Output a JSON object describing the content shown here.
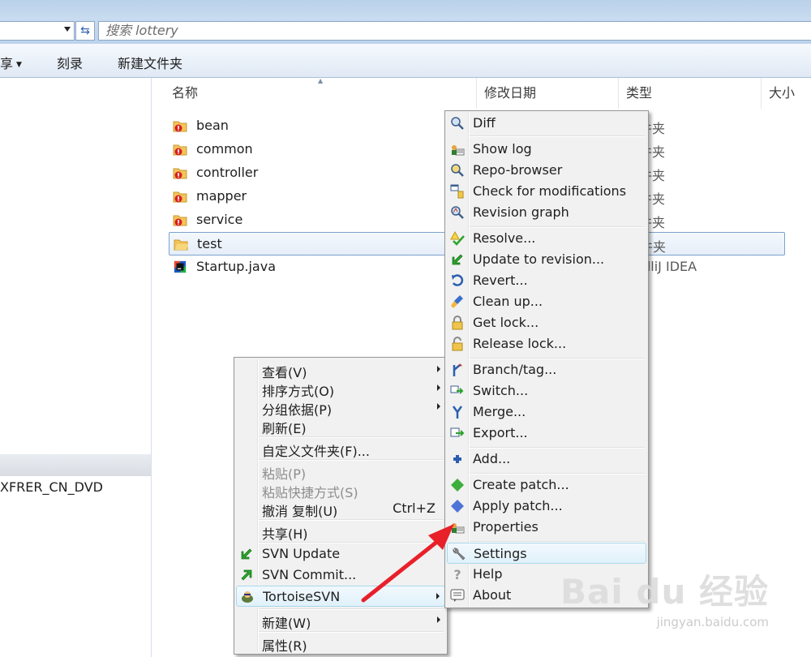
{
  "address_bar": {
    "search_placeholder": "搜索 lottery"
  },
  "toolbar": {
    "share_label": "享",
    "burn_label": "刻录",
    "new_folder_label": "新建文件夹"
  },
  "nav_pane": {
    "selected_item": "",
    "drive_item": "XFRER_CN_DVD"
  },
  "columns": {
    "name": "名称",
    "modified": "修改日期",
    "type": "类型",
    "size": "大小"
  },
  "files": [
    {
      "name": "bean",
      "type": "件夹",
      "icon": "svn-folder-icon"
    },
    {
      "name": "common",
      "type": "件夹",
      "icon": "svn-folder-icon"
    },
    {
      "name": "controller",
      "type": "件夹",
      "icon": "svn-folder-icon"
    },
    {
      "name": "mapper",
      "type": "件夹",
      "icon": "svn-folder-icon"
    },
    {
      "name": "service",
      "type": "件夹",
      "icon": "svn-folder-icon"
    },
    {
      "name": "test",
      "type": "件夹",
      "icon": "folder-icon"
    },
    {
      "name": "Startup.java",
      "type": "elliJ IDEA",
      "icon": "intellij-file-icon"
    }
  ],
  "explorer_menu": {
    "view": "查看(V)",
    "sort_by": "排序方式(O)",
    "group_by": "分组依据(P)",
    "refresh": "刷新(E)",
    "customize": "自定义文件夹(F)...",
    "paste": "粘贴(P)",
    "paste_shortcut": "粘贴快捷方式(S)",
    "undo_copy": "撤消 复制(U)",
    "undo_shortcut": "Ctrl+Z",
    "share": "共享(H)",
    "svn_update": "SVN Update",
    "svn_commit": "SVN Commit...",
    "tortoisesvn": "TortoiseSVN",
    "new": "新建(W)",
    "properties": "属性(R)"
  },
  "svn_menu": {
    "diff": "Diff",
    "show_log": "Show log",
    "repo_browser": "Repo-browser",
    "check_mods": "Check for modifications",
    "revision_graph": "Revision graph",
    "resolve": "Resolve...",
    "update_to_revision": "Update to revision...",
    "revert": "Revert...",
    "clean_up": "Clean up...",
    "get_lock": "Get lock...",
    "release_lock": "Release lock...",
    "branch_tag": "Branch/tag...",
    "switch": "Switch...",
    "merge": "Merge...",
    "export": "Export...",
    "add": "Add...",
    "create_patch": "Create patch...",
    "apply_patch": "Apply patch...",
    "properties": "Properties",
    "settings": "Settings",
    "help": "Help",
    "about": "About"
  },
  "watermark": {
    "brand": "Bai du 经验",
    "url": "jingyan.baidu.com"
  },
  "colors": {
    "selection_border": "#7da2ce",
    "hover_fill": "#e0f1fa",
    "arrow": "#e8202a"
  }
}
